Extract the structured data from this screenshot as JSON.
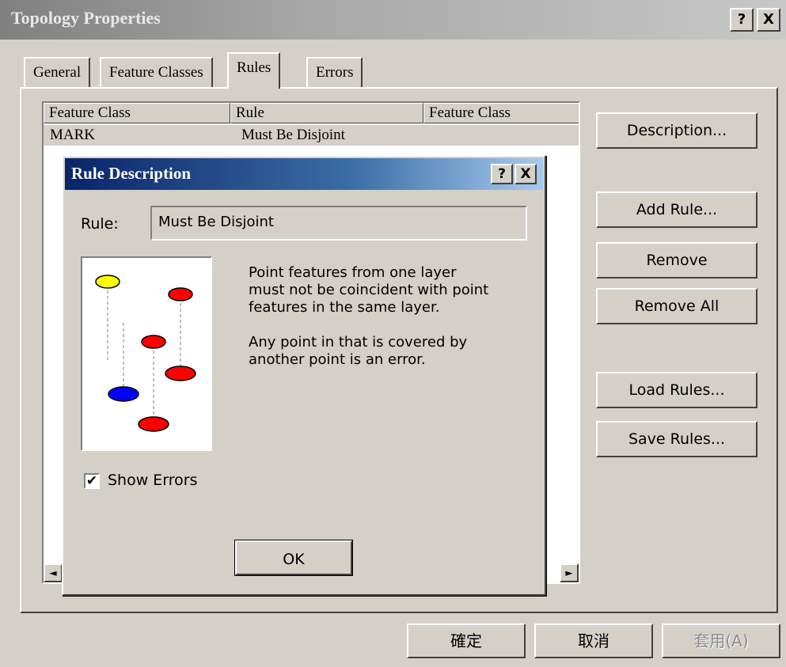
{
  "window": {
    "title": "Topology Properties",
    "help_btn": "?",
    "close_btn": "X"
  },
  "tabs": [
    {
      "label": "General"
    },
    {
      "label": "Feature Classes"
    },
    {
      "label": "Rules",
      "active": true
    },
    {
      "label": "Errors"
    }
  ],
  "rules_table": {
    "columns": [
      "Feature Class",
      "Rule",
      "Feature Class"
    ],
    "rows": [
      {
        "feature_class": "MARK",
        "rule": "Must Be Disjoint",
        "feature_class_2": ""
      }
    ]
  },
  "side_buttons": {
    "description": "Description...",
    "add_rule": "Add Rule...",
    "remove": "Remove",
    "remove_all": "Remove All",
    "load_rules": "Load Rules...",
    "save_rules": "Save Rules..."
  },
  "bottom_buttons": {
    "ok": "確定",
    "cancel": "取消",
    "apply": "套用(A)"
  },
  "rule_dialog": {
    "title": "Rule Description",
    "help_btn": "?",
    "close_btn": "X",
    "rule_label": "Rule:",
    "rule_value": "Must Be Disjoint",
    "description": "Point features from one layer\nmust not be coincident with point\nfeatures in the same layer.\n\nAny point in that is covered by\nanother point is an error.",
    "show_errors_label": "Show Errors",
    "show_errors_checked": true,
    "ok_label": "OK",
    "colors": {
      "yellow": "#ffff00",
      "red": "#ff0000",
      "blue": "#0000ff"
    }
  },
  "scroll": {
    "left_arrow": "◄",
    "right_arrow": "►"
  }
}
